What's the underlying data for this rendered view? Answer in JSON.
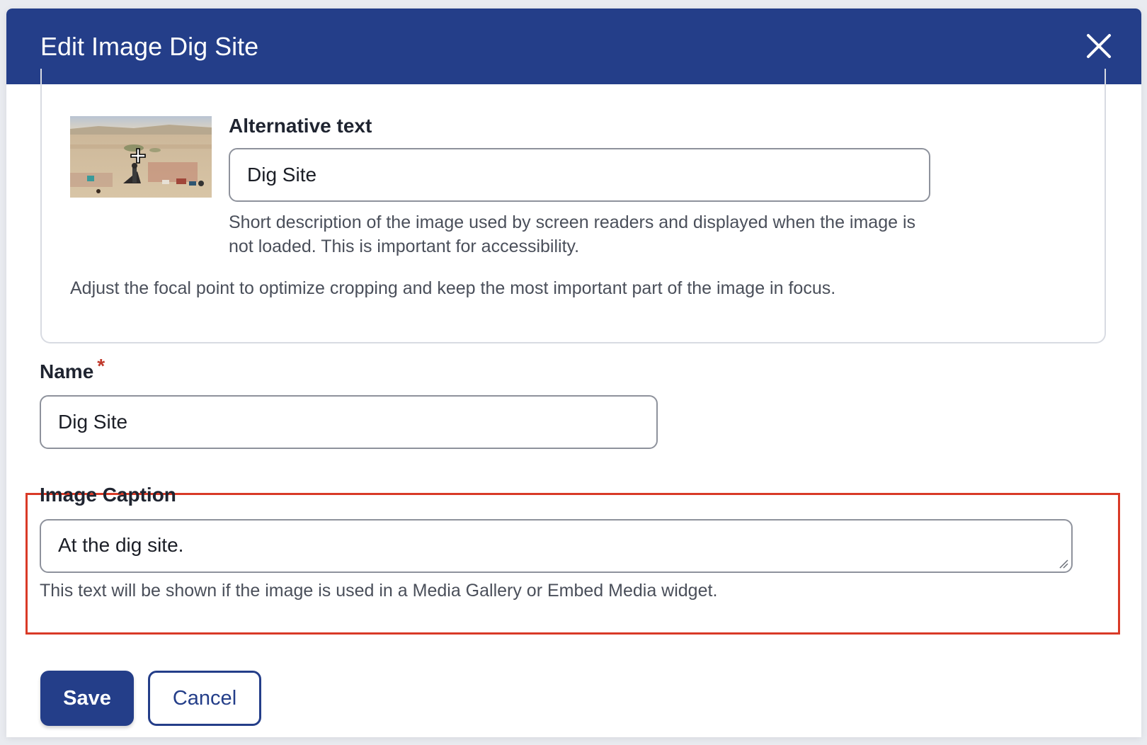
{
  "dialog": {
    "title": "Edit Image Dig Site",
    "close_icon": "close-icon"
  },
  "focal_point": {
    "thumbnail_icon": "image-thumbnail",
    "crosshair_icon": "crosshair-icon",
    "alt_text": {
      "label": "Alternative text",
      "value": "Dig Site",
      "help": "Short description of the image used by screen readers and displayed when the image is not loaded. This is important for accessibility."
    },
    "instructions": "Adjust the focal point to optimize cropping and keep the most important part of the image in focus."
  },
  "name_field": {
    "label": "Name",
    "required_marker": "*",
    "value": "Dig Site"
  },
  "caption_field": {
    "label": "Image Caption",
    "value": "At the dig site.",
    "help": "This text will be shown if the image is used in a Media Gallery or Embed Media widget."
  },
  "actions": {
    "save_label": "Save",
    "cancel_label": "Cancel"
  },
  "colors": {
    "header_bg": "#243e89",
    "primary": "#243e89",
    "highlight": "#d93a27",
    "required": "#c0392b"
  }
}
